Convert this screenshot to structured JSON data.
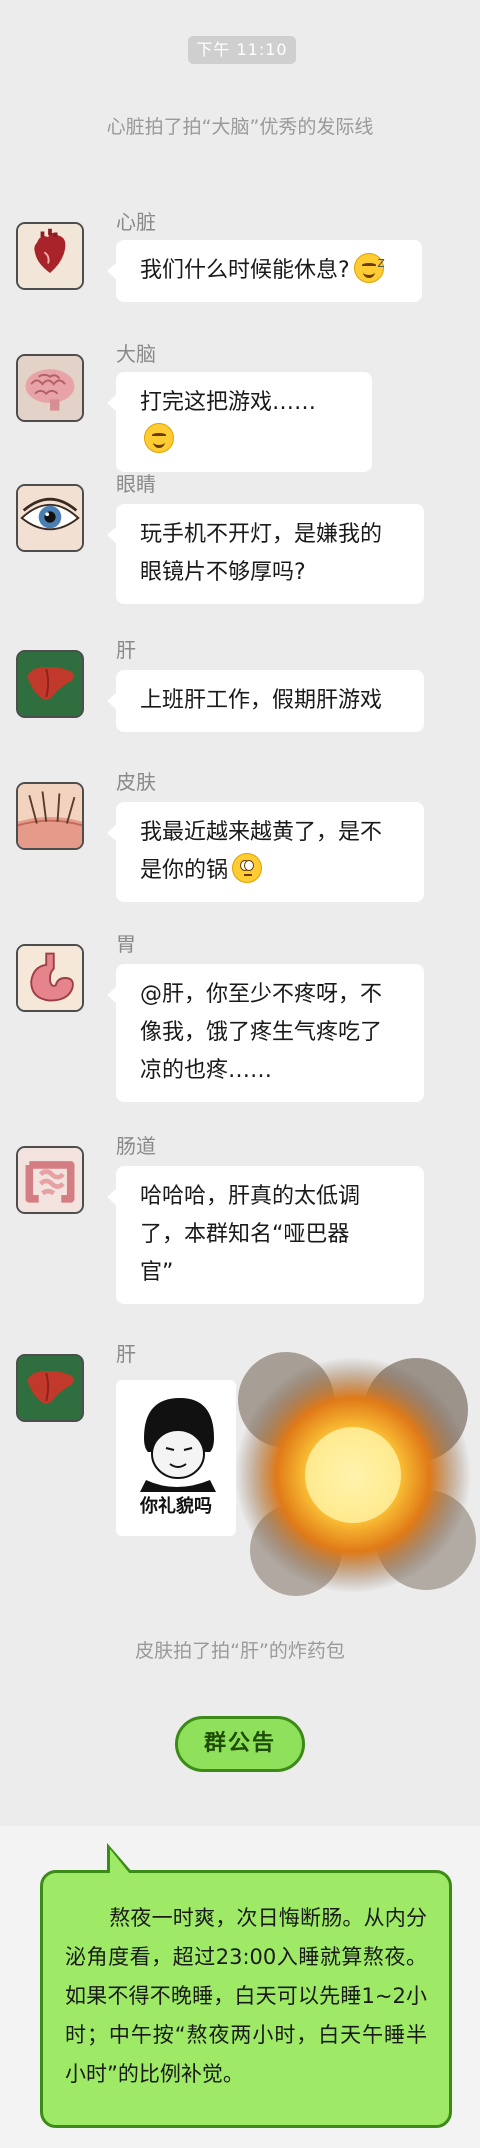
{
  "status": {
    "time": "下午 11:10"
  },
  "system_messages": {
    "pat_heart_brain": "心脏拍了拍“大脑”优秀的发际线",
    "pat_skin_liver": "皮肤拍了拍“肝”的炸药包"
  },
  "messages": [
    {
      "sender": "心脏",
      "avatar_icon": "heart-icon",
      "lines": [
        "我们什么时候能休息?"
      ],
      "emoji": "sleepy-face-emoji"
    },
    {
      "sender": "大脑",
      "avatar_icon": "brain-icon",
      "lines": [
        "打完这把游戏……"
      ],
      "emoji": "grinning-face-emoji"
    },
    {
      "sender": "眼睛",
      "avatar_icon": "eye-icon",
      "lines": [
        "玩手机不开灯，是嫌我的",
        "眼镜片不够厚吗?"
      ]
    },
    {
      "sender": "肝",
      "avatar_icon": "liver-icon",
      "lines": [
        "上班肝工作，假期肝游戏"
      ]
    },
    {
      "sender": "皮肤",
      "avatar_icon": "skin-icon",
      "lines": [
        "我最近越来越黄了，是不",
        "是你的锅"
      ],
      "emoji": "eye-roll-emoji"
    },
    {
      "sender": "胃",
      "avatar_icon": "stomach-icon",
      "lines": [
        "@肝，你至少不疼呀，不",
        "像我，饿了疼生气疼吃了",
        "凉的也疼……"
      ]
    },
    {
      "sender": "肠道",
      "avatar_icon": "intestine-icon",
      "lines": [
        "哈哈哈，肝真的太低调",
        "了，本群知名“哑巴器",
        "官”"
      ]
    },
    {
      "sender": "肝",
      "avatar_icon": "liver-icon",
      "sticker_caption": "你礼貌吗"
    }
  ],
  "announcement": {
    "button_label": "群公告",
    "text": "熬夜一时爽，次日悔断肠。从内分泌角度看，超过23:00入睡就算熬夜。如果不得不晚睡，白天可以先睡1~2小时；中午按“熬夜两小时，白天午睡半小时”的比例补觉。"
  },
  "colors": {
    "chat_bg": "#ececec",
    "bubble_bg": "#ffffff",
    "notice_bg": "#9eea66",
    "notice_border": "#3c8a17"
  }
}
